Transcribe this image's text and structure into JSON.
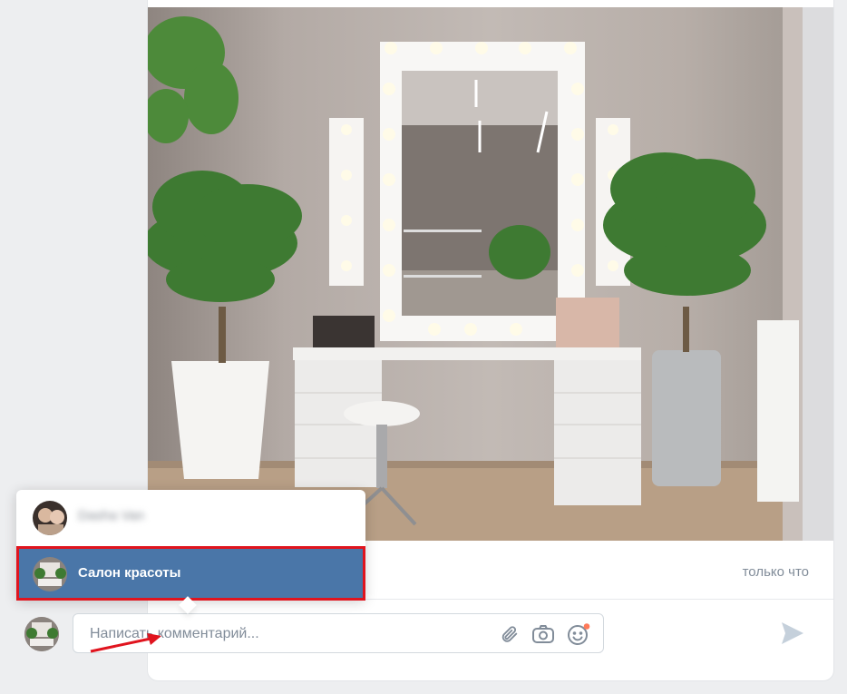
{
  "post": {
    "timestamp": "только что",
    "accent_color": "#4a76a8"
  },
  "composer": {
    "placeholder": "Написать комментарий...",
    "attach_icon": "paperclip-icon",
    "camera_icon": "camera-icon",
    "emoji_icon": "smiley-icon",
    "send_icon": "send-icon"
  },
  "author_picker": {
    "items": [
      {
        "name": "Dasha Van",
        "blurred": true
      },
      {
        "name": "Салон красоты",
        "selected": true
      }
    ],
    "highlight_color": "#e0141e"
  }
}
